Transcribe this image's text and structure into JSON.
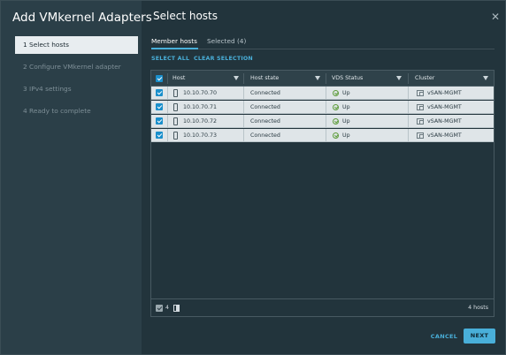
{
  "wizard": {
    "title": "Add VMkernel Adapters",
    "steps": [
      {
        "label": "1  Select hosts",
        "active": true
      },
      {
        "label": "2  Configure VMkernel adapter",
        "active": false
      },
      {
        "label": "3  IPv4 settings",
        "active": false
      },
      {
        "label": "4  Ready to complete",
        "active": false
      }
    ]
  },
  "page": {
    "title": "Select hosts",
    "close_glyph": "✕",
    "tabs": [
      {
        "label": "Member hosts",
        "active": true
      },
      {
        "label": "Selected (4)",
        "active": false
      }
    ],
    "actions": {
      "select_all": "SELECT ALL",
      "clear_selection": "CLEAR SELECTION"
    }
  },
  "grid": {
    "columns": [
      "Host",
      "Host state",
      "VDS Status",
      "Cluster"
    ],
    "rows": [
      {
        "host": "10.10.70.70",
        "state": "Connected",
        "vds": "Up",
        "cluster": "vSAN-MGMT",
        "checked": true
      },
      {
        "host": "10.10.70.71",
        "state": "Connected",
        "vds": "Up",
        "cluster": "vSAN-MGMT",
        "checked": true
      },
      {
        "host": "10.10.70.72",
        "state": "Connected",
        "vds": "Up",
        "cluster": "vSAN-MGMT",
        "checked": true
      },
      {
        "host": "10.10.70.73",
        "state": "Connected",
        "vds": "Up",
        "cluster": "vSAN-MGMT",
        "checked": true
      }
    ],
    "footer": {
      "selected_count": "4",
      "total": "4 hosts"
    }
  },
  "buttons": {
    "cancel": "CANCEL",
    "next": "NEXT"
  },
  "colors": {
    "accent": "#49afd9",
    "panel": "#22343c",
    "sidebar": "#2b3f48",
    "row": "#dfe5e8",
    "status_ok": "#5d9c3a"
  }
}
